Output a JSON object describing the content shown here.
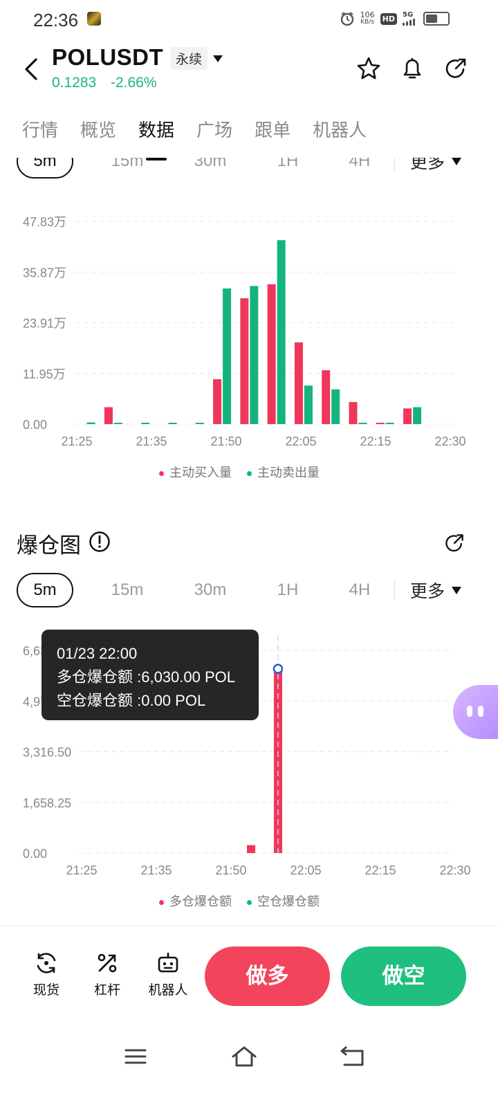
{
  "status_bar": {
    "time": "22:36",
    "net_speed_value": "106",
    "net_speed_unit": "KB/s",
    "hd_label": "HD",
    "network": "5G",
    "battery_level": 0.6
  },
  "header": {
    "symbol": "POLUSDT",
    "contract_type": "永续",
    "price": "0.1283",
    "change": "-2.66%",
    "price_color": "#1db37a"
  },
  "nav_tabs": [
    {
      "label": "行情",
      "active": false
    },
    {
      "label": "概览",
      "active": false
    },
    {
      "label": "数据",
      "active": true
    },
    {
      "label": "广场",
      "active": false
    },
    {
      "label": "跟单",
      "active": false
    },
    {
      "label": "机器人",
      "active": false
    }
  ],
  "intervals": {
    "options": [
      "5m",
      "15m",
      "30m",
      "1H",
      "4H"
    ],
    "selected": "5m",
    "more_label": "更多"
  },
  "volume_chart": {
    "chart_data": {
      "type": "bar",
      "categories": [
        "21:25",
        "21:30",
        "21:35",
        "21:40",
        "21:45",
        "21:50",
        "21:55",
        "22:00",
        "22:05",
        "22:10",
        "22:15",
        "22:20",
        "22:25",
        "22:30"
      ],
      "y_ticks": [
        "0.00",
        "11.95万",
        "23.91万",
        "35.87万",
        "47.83万"
      ],
      "x_ticks": [
        "21:25",
        "21:35",
        "21:50",
        "22:05",
        "22:15",
        "22:30"
      ],
      "ylim": [
        0,
        478300
      ],
      "series": [
        {
          "name": "主动买入量",
          "color": "#f0365a",
          "values": [
            0,
            40000,
            0,
            0,
            0,
            106000,
            297000,
            330000,
            193000,
            127000,
            52000,
            2000,
            37000
          ]
        },
        {
          "name": "主动卖出量",
          "color": "#14b47e",
          "values": [
            4000,
            3000,
            1000,
            1000,
            1000,
            320000,
            326000,
            434000,
            91000,
            82000,
            1000,
            1000,
            40000
          ]
        }
      ]
    }
  },
  "liquidation": {
    "title": "爆仓图",
    "chart_data": {
      "type": "bar",
      "categories": [
        "21:25",
        "21:30",
        "21:35",
        "21:40",
        "21:45",
        "21:50",
        "21:55",
        "22:00",
        "22:05",
        "22:10",
        "22:15",
        "22:20",
        "22:25",
        "22:30"
      ],
      "y_ticks": [
        "0.00",
        "1,658.25",
        "3,316.50",
        "4,974.75",
        "6,633.00"
      ],
      "x_ticks": [
        "21:25",
        "21:35",
        "21:50",
        "22:05",
        "22:15",
        "22:30"
      ],
      "ylim": [
        0,
        6633
      ],
      "series": [
        {
          "name": "多仓爆仓额",
          "color": "#f0365a",
          "values": [
            0,
            0,
            0,
            0,
            0,
            0,
            260,
            6030,
            0,
            0,
            0,
            0,
            0,
            0
          ]
        },
        {
          "name": "空仓爆仓额",
          "color": "#14b47e",
          "values": [
            0,
            0,
            0,
            0,
            0,
            0,
            0,
            0,
            0,
            0,
            0,
            0,
            0,
            0
          ]
        }
      ]
    },
    "tooltip": {
      "time": "01/23 22:00",
      "long_line": "多仓爆仓额 :6,030.00 POL",
      "short_line": "空仓爆仓额 :0.00 POL"
    }
  },
  "bottom_bar": {
    "spot_label": "现货",
    "margin_label": "杠杆",
    "bot_label": "机器人",
    "long_label": "做多",
    "short_label": "做空"
  }
}
